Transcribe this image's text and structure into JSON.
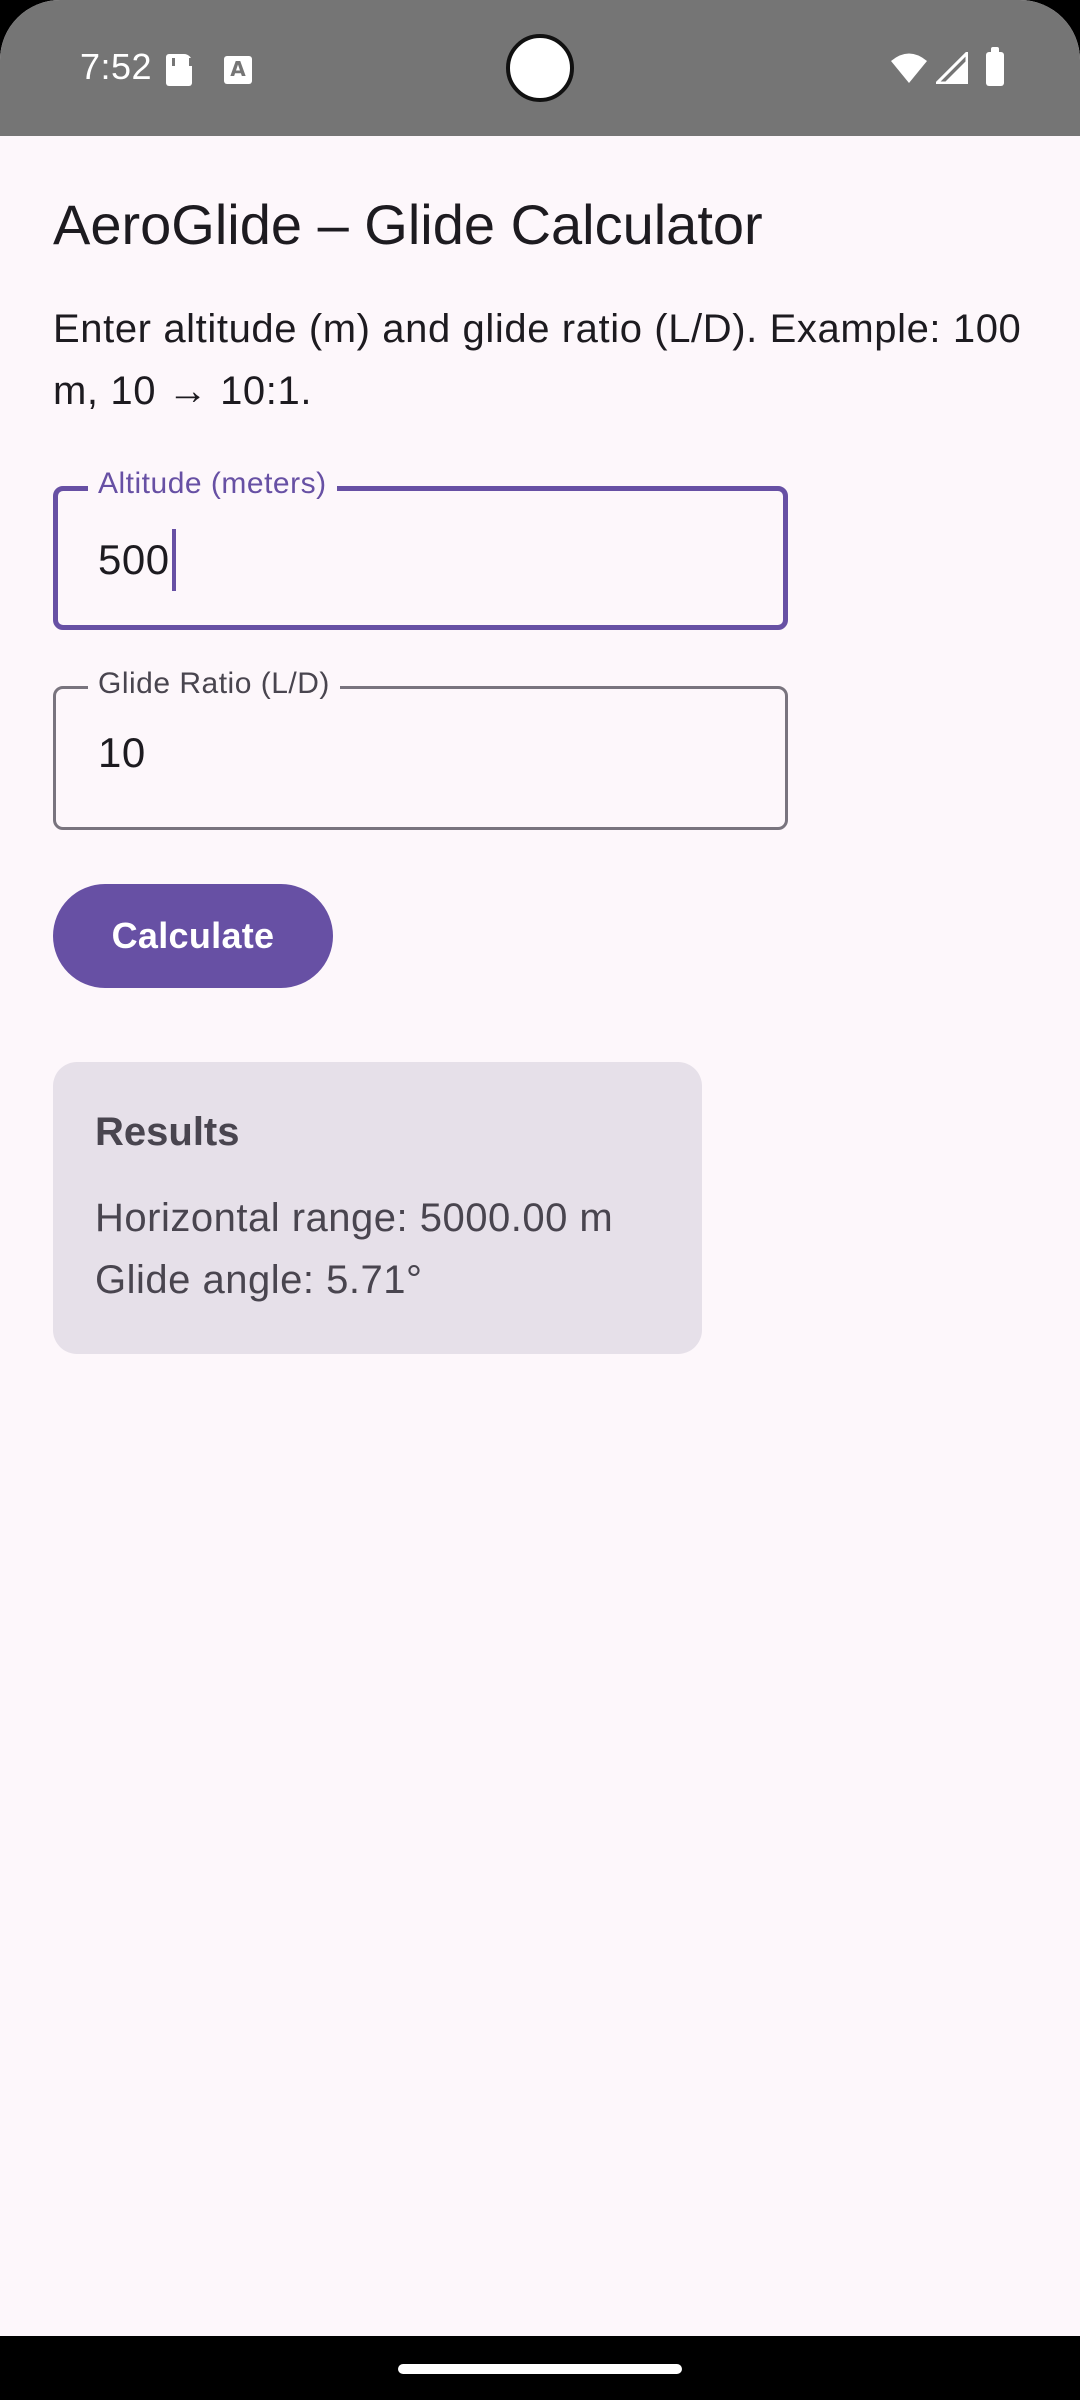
{
  "status_bar": {
    "time": "7:52",
    "icons": [
      "sd-card-icon",
      "font-icon",
      "wifi-icon",
      "signal-icon",
      "battery-icon"
    ],
    "font_icon_glyph": "A"
  },
  "app": {
    "title": "AeroGlide – Glide Calculator",
    "description": "Enter altitude (m) and glide ratio (L/D). Example: 100 m, 10 → 10:1."
  },
  "form": {
    "altitude": {
      "label": "Altitude (meters)",
      "value": "500",
      "focused": true
    },
    "glide_ratio": {
      "label": "Glide Ratio (L/D)",
      "value": "10",
      "focused": false
    },
    "calculate_label": "Calculate"
  },
  "results": {
    "title": "Results",
    "horizontal_range": "Horizontal range: 5000.00 m",
    "glide_angle": "Glide angle: 5.71°"
  },
  "colors": {
    "primary": "#6750a4",
    "background": "#fdf7fb",
    "card": "#e6e0e9",
    "status_bar": "#757575",
    "text": "#1d1b20"
  }
}
